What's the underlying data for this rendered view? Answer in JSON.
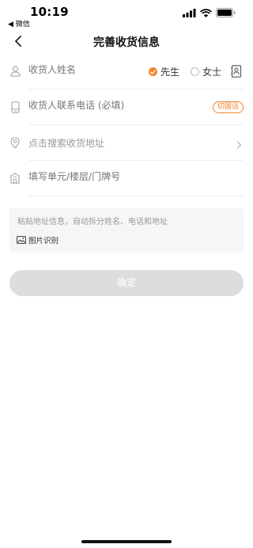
{
  "status_bar": {
    "time": "10:19",
    "back_app_label": "◀ 微信"
  },
  "nav": {
    "title": "完善收货信息"
  },
  "form": {
    "name_placeholder": "收货人姓名",
    "gender_options": [
      "先生",
      "女士"
    ],
    "gender_selected": "先生",
    "phone_placeholder": "收货人联系电话 (必填)",
    "switch_phone_label": "切国话",
    "address_placeholder": "点击搜索收货地址",
    "detail_placeholder": "填写单元/楼层/门牌号"
  },
  "paste": {
    "hint": "粘贴地址信息，自动拆分姓名、电话和地址",
    "image_recognize_label": "图片识别"
  },
  "confirm_label": "确定",
  "colors": {
    "accent": "#f0842c",
    "button_disabled": "#dddddd"
  },
  "icons": [
    "signal-icon",
    "wifi-icon",
    "battery-icon",
    "back-arrow-icon",
    "person-icon",
    "contact-book-icon",
    "phone-icon",
    "location-pin-icon",
    "building-icon",
    "chevron-right-icon",
    "image-icon"
  ]
}
